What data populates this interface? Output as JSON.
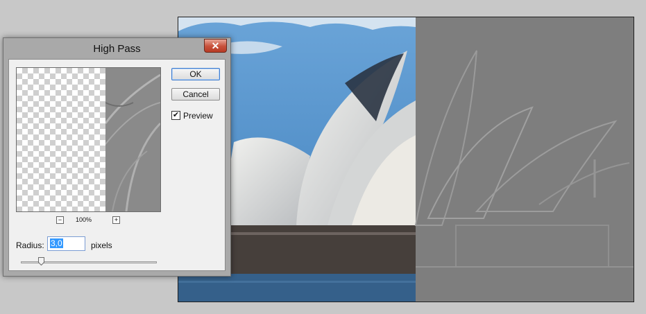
{
  "dialog": {
    "title": "High Pass",
    "close_label": "✕",
    "ok_label": "OK",
    "cancel_label": "Cancel",
    "preview_label": "Preview",
    "preview_checked": true,
    "zoom_out_label": "−",
    "zoom_in_label": "+",
    "zoom_level": "100%",
    "radius_label": "Radius:",
    "radius_value": "3,0",
    "radius_unit": "pixels",
    "slider_fraction": 0.15
  },
  "colors": {
    "sky": "#4a8ac4",
    "shell": "#e9e9e6",
    "water": "#35608a",
    "high_pass_gray": "#808080",
    "close_red": "#c7503a"
  },
  "icons": {
    "close": "close-icon",
    "checkmark": "checkmark-icon",
    "slider_thumb": "slider-thumb-icon"
  }
}
